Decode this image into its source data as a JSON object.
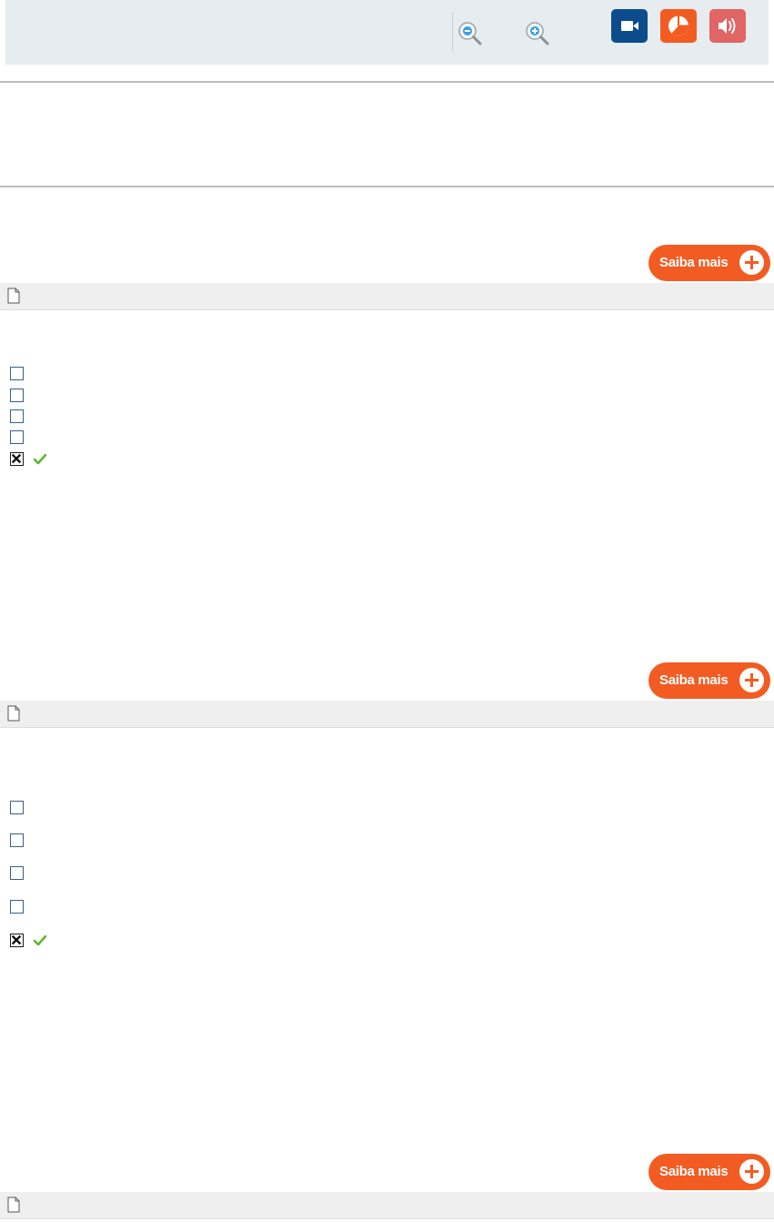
{
  "toolbar": {
    "zoom_out_icon": "magnifier-minus-icon",
    "zoom_in_icon": "magnifier-plus-icon",
    "video_icon": "video-camera-icon",
    "chart_icon": "pie-chart-icon",
    "audio_icon": "speaker-icon",
    "colors": {
      "video": "#0d4c8b",
      "chart": "#f25c22",
      "audio": "#e06565",
      "zoom_accent": "#3aa0e0"
    }
  },
  "sections": [
    {
      "saiba_label": "Saiba mais",
      "options": [
        {
          "checked": false
        },
        {
          "checked": false
        },
        {
          "checked": false
        },
        {
          "checked": false
        },
        {
          "checked": true,
          "correct": true
        }
      ]
    },
    {
      "saiba_label": "Saiba mais",
      "options": [
        {
          "checked": false
        },
        {
          "checked": false
        },
        {
          "checked": false
        },
        {
          "checked": false
        },
        {
          "checked": true,
          "correct": true
        }
      ]
    },
    {
      "saiba_label": "Saiba mais"
    }
  ],
  "accent": "#f25c22"
}
